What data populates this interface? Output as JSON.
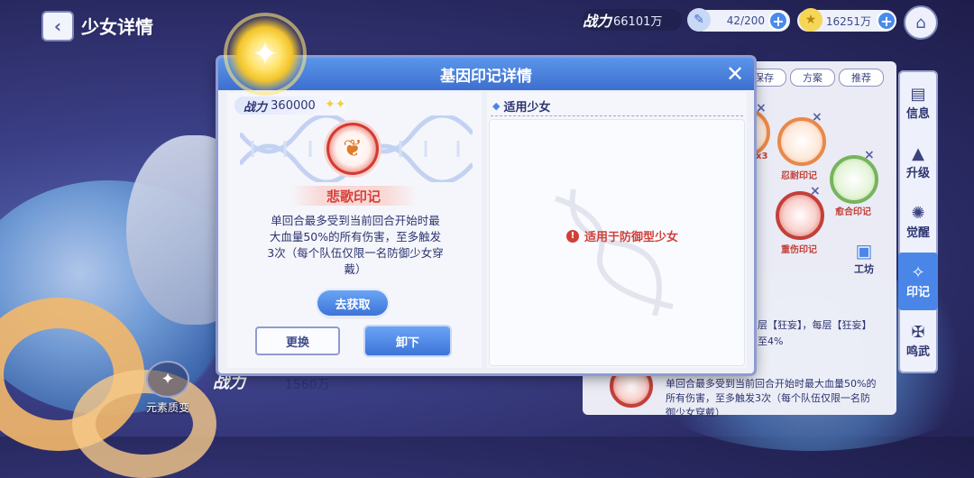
{
  "header": {
    "title": "少女详情",
    "power_label": "战力",
    "power_value": "66101万",
    "stamina": "42/200",
    "gold": "16251万"
  },
  "side_nav": [
    {
      "label": "信息",
      "icon": "info-icon"
    },
    {
      "label": "升级",
      "icon": "levelup-icon"
    },
    {
      "label": "觉醒",
      "icon": "awaken-icon"
    },
    {
      "label": "印记",
      "icon": "mark-icon",
      "active": true
    },
    {
      "label": "鸣武",
      "icon": "weapon-icon"
    }
  ],
  "background_panel": {
    "tabs": [
      "保存",
      "方案",
      "推荐"
    ],
    "node_labels": [
      "忍耐印记",
      "愈合印记",
      "重伤印记"
    ],
    "node_partial": "x3",
    "workshop_label": "工坊",
    "text_line1": "层【狂妄】，每层【狂妄】",
    "text_line2": "至4%",
    "bottom_desc_1": "单回合最多受到当前回合开始时最大血量50%的",
    "bottom_desc_2": "所有伤害，至多触发3次（每个队伍仅限一名防",
    "bottom_desc_3": "御少女穿戴）"
  },
  "bottom": {
    "transform_label": "元素质变",
    "power_label": "战力",
    "power_value": "1560万"
  },
  "modal": {
    "title": "基因印记详情",
    "power_label": "战力",
    "power_value": "360000",
    "mark_name": "悲歌印记",
    "description": "单回合最多受到当前回合开始时最大血量50%的所有伤害，至多触发3次（每个队伍仅限一名防御少女穿戴）",
    "obtain_button": "去获取",
    "replace_button": "更换",
    "unload_button": "卸下",
    "applicable_title": "适用少女",
    "applicable_message": "适用于防御型少女"
  },
  "colors": {
    "accent_blue": "#4a86e8",
    "warning_red": "#d0403a",
    "text_navy": "#2c3470"
  }
}
